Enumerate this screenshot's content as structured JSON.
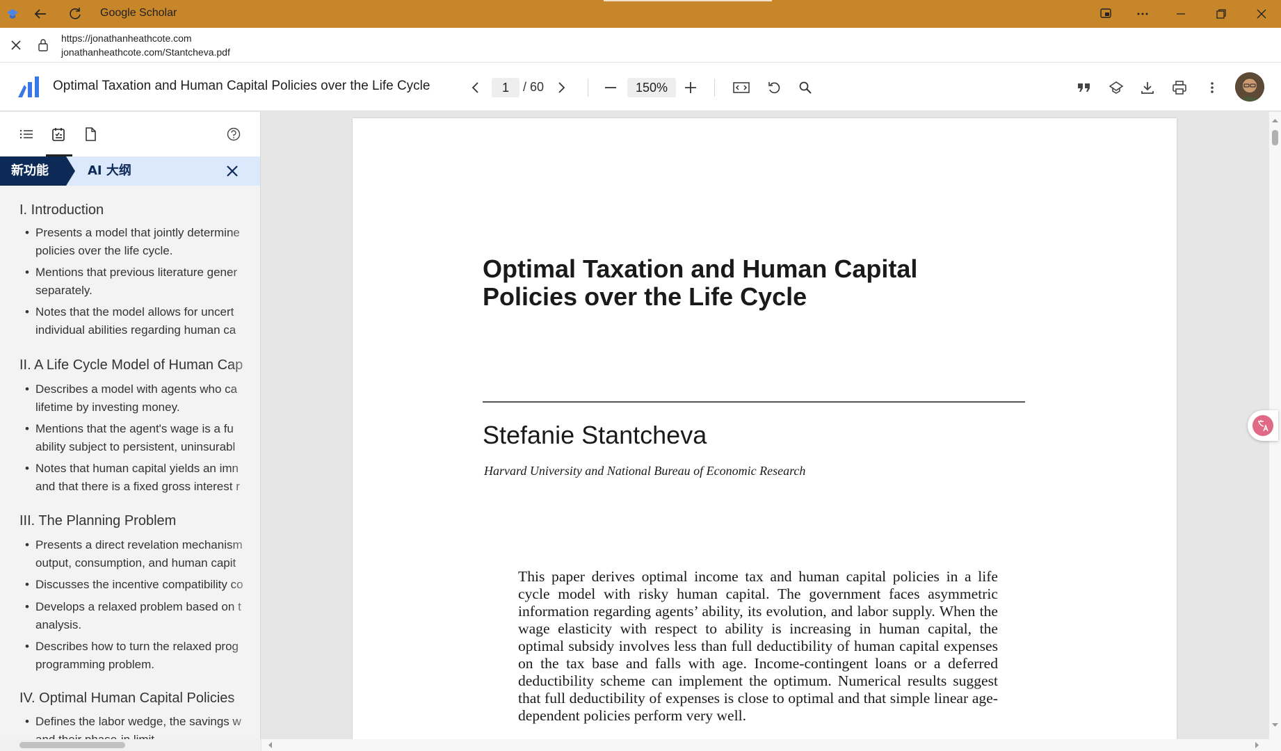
{
  "titlebar": {
    "title": "Google Scholar"
  },
  "address": {
    "origin": "https://jonathanheathcote.com",
    "path": "jonathanheathcote.com/Stantcheva.pdf"
  },
  "toolbar": {
    "doc_title": "Optimal Taxation and Human Capital Policies over the Life Cycle",
    "page_current": "1",
    "page_total": "/ 60",
    "zoom": "150%"
  },
  "sidebar": {
    "banner_new": "新功能",
    "banner_title": "AI 大纲",
    "sections": [
      {
        "title": "I. Introduction",
        "bullets": [
          [
            "Presents a model that jointly determine",
            "policies over the life cycle."
          ],
          [
            "Mentions that previous literature gener",
            "separately."
          ],
          [
            "Notes that the model allows for uncert",
            "individual abilities regarding human ca"
          ]
        ]
      },
      {
        "title": "II. A Life Cycle Model of Human Cap",
        "bullets": [
          [
            "Describes a model with agents who ca",
            "lifetime by investing money."
          ],
          [
            "Mentions that the agent's wage is a fu",
            "ability subject to persistent, uninsurabl"
          ],
          [
            "Notes that human capital yields an imn",
            "and that there is a fixed gross interest r"
          ]
        ]
      },
      {
        "title": "III. The Planning Problem",
        "bullets": [
          [
            "Presents a direct revelation mechanism",
            "output, consumption, and human capit"
          ],
          [
            "Discusses the incentive compatibility co"
          ],
          [
            "Develops a relaxed problem based on t",
            "analysis."
          ],
          [
            "Describes how to turn the relaxed prog",
            "programming problem."
          ]
        ]
      },
      {
        "title": "IV. Optimal Human Capital Policies",
        "bullets": [
          [
            "Defines the labor wedge, the savings w",
            "and their phase-in limit"
          ]
        ]
      }
    ]
  },
  "pdf": {
    "title_line1": "Optimal Taxation and Human Capital",
    "title_line2": "Policies over the Life Cycle",
    "author": "Stefanie Stantcheva",
    "affiliation": "Harvard University and National Bureau of Economic Research",
    "abstract": "This paper derives optimal income tax and human capital policies in a life cycle model with risky human capital. The government faces asymmetric information regarding agents’ ability, its evolution, and labor supply. When the wage elasticity with respect to ability is increasing in human capital, the optimal subsidy involves less than full deductibility of human capital expenses on the tax base and falls with age. Income-contingent loans or a deferred deductibility scheme can implement the optimum. Numerical results suggest that full deductibility of expenses is close to optimal and that simple linear age-dependent policies perform very well."
  },
  "colors": {
    "titlebar": "#c8862b",
    "banner_dark": "#0d2a57",
    "banner_light": "#dce8fb",
    "logo_blue": "#3b78e7"
  }
}
